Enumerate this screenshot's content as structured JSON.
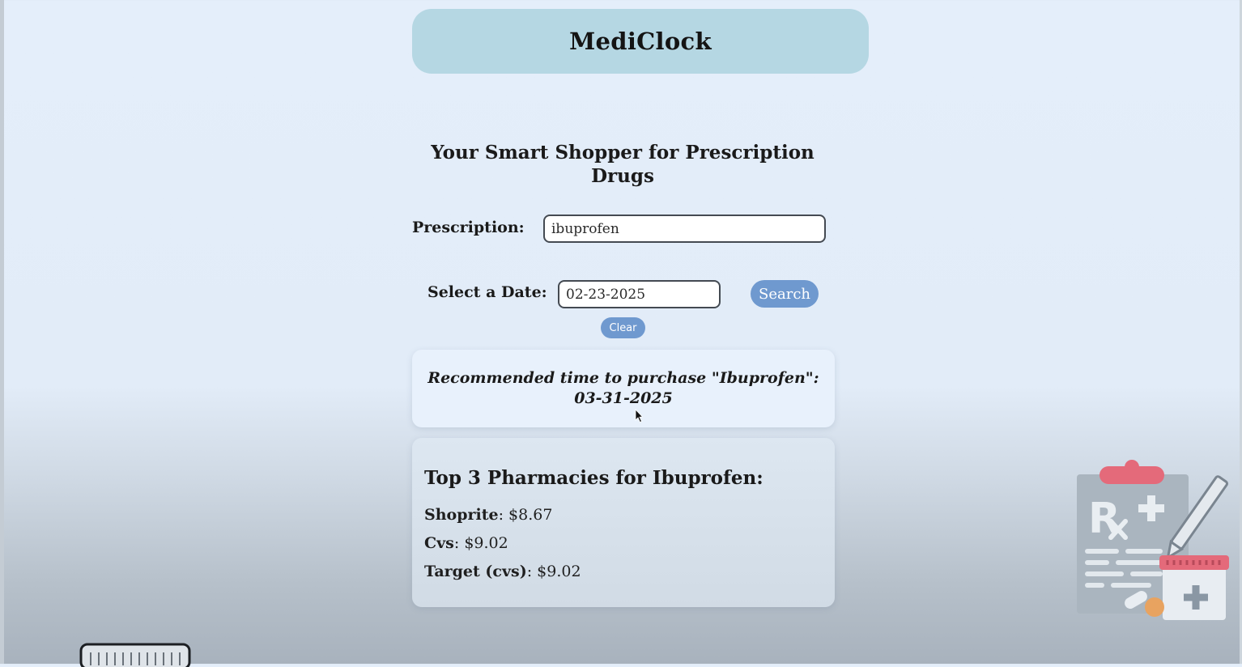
{
  "app": {
    "title": "MediClock",
    "subtitle": "Your Smart Shopper for Prescription Drugs"
  },
  "form": {
    "prescription_label": "Prescription:",
    "prescription_value": "ibuprofen",
    "date_label": "Select a Date:",
    "date_value": "02-23-2025",
    "search_label": "Search",
    "clear_label": "Clear"
  },
  "recommendation": {
    "text": "Recommended time to purchase \"Ibuprofen\": 03-31-2025"
  },
  "pharmacies": {
    "title": "Top 3 Pharmacies for Ibuprofen:",
    "items": [
      {
        "name": "Shoprite",
        "price": "$8.67"
      },
      {
        "name": "Cvs",
        "price": "$9.02"
      },
      {
        "name": "Target (cvs)",
        "price": "$9.02"
      }
    ]
  },
  "icons": {
    "illustration": "prescription-clipboard-icon",
    "decor": "pill-bottle-cap-icon",
    "pointer": "mouse-cursor-icon"
  },
  "colors": {
    "header_bg": "#b5d7e3",
    "button_bg": "#6f99cf",
    "page_bg": "#e4eefa",
    "card_bg": "#e8f1fc"
  }
}
